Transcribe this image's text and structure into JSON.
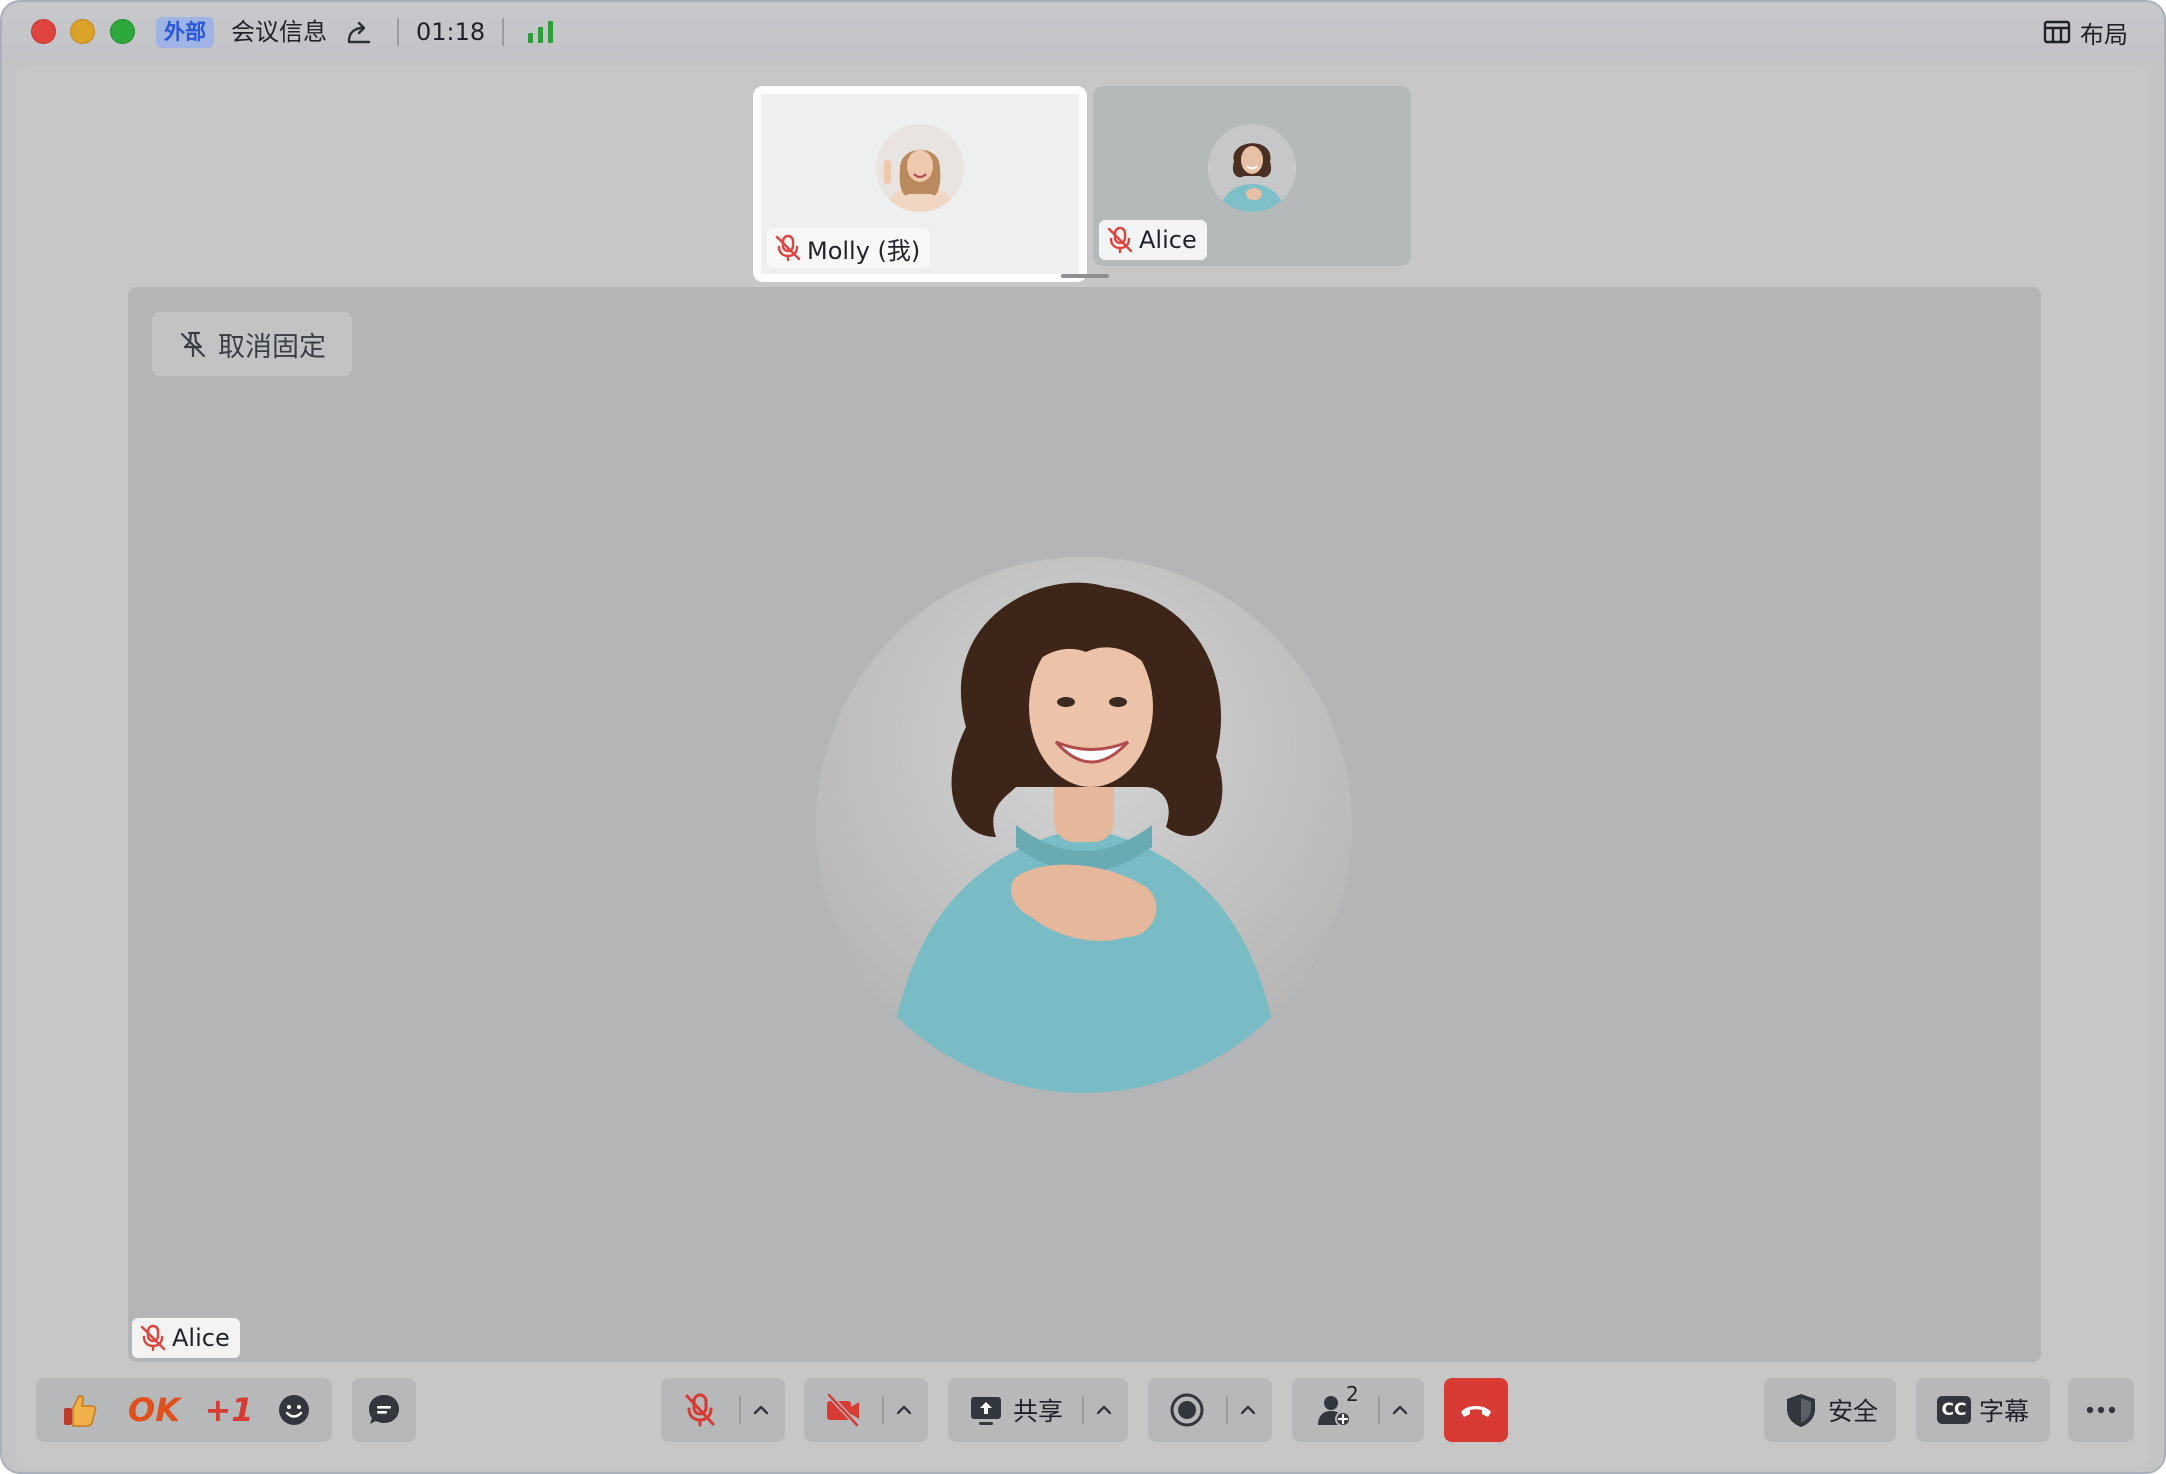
{
  "titlebar": {
    "external_badge": "外部",
    "meeting_info": "会议信息",
    "timer": "01:18",
    "layout_label": "布局"
  },
  "participants": {
    "self_name": "Molly (我)",
    "other_name": "Alice"
  },
  "main": {
    "unpin_label": "取消固定",
    "speaker_name": "Alice"
  },
  "reactions": {
    "ok_label": "OK",
    "plus_one_label": "+1"
  },
  "toolbar": {
    "share_label": "共享",
    "participant_count": "2",
    "security_label": "安全",
    "captions_label": "字幕",
    "cc_glyph": "CC"
  },
  "colors": {
    "accent_red": "#d83a34",
    "muted_red": "#e0443e",
    "signal_green": "#2e9e3a",
    "badge_blue": "#2a57d6"
  }
}
